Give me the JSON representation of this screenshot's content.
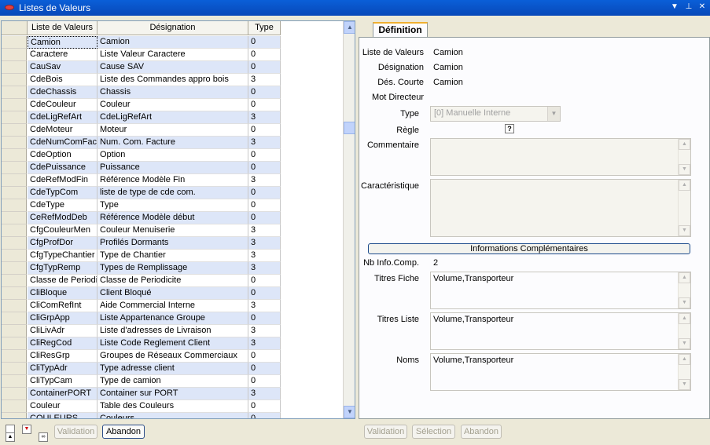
{
  "window": {
    "title": "Listes de Valeurs"
  },
  "grid": {
    "headers": [
      "Liste de Valeurs",
      "Désignation",
      "Type"
    ],
    "rows": [
      [
        "Camion",
        "Camion",
        "0"
      ],
      [
        "Caractere",
        "Liste Valeur Caractere",
        "0"
      ],
      [
        "CauSav",
        "Cause SAV",
        "0"
      ],
      [
        "CdeBois",
        "Liste des Commandes appro bois",
        "3"
      ],
      [
        "CdeChassis",
        "Chassis",
        "0"
      ],
      [
        "CdeCouleur",
        "Couleur",
        "0"
      ],
      [
        "CdeLigRefArt",
        "CdeLigRefArt",
        "3"
      ],
      [
        "CdeMoteur",
        "Moteur",
        "0"
      ],
      [
        "CdeNumComFacture",
        "Num. Com. Facture",
        "3"
      ],
      [
        "CdeOption",
        "Option",
        "0"
      ],
      [
        "CdePuissance",
        "Puissance",
        "0"
      ],
      [
        "CdeRefModFin",
        "Référence Modèle Fin",
        "3"
      ],
      [
        "CdeTypCom",
        "liste de type de cde com.",
        "0"
      ],
      [
        "CdeType",
        "Type",
        "0"
      ],
      [
        "CeRefModDeb",
        "Référence Modèle début",
        "0"
      ],
      [
        "CfgCouleurMen",
        "Couleur Menuiserie",
        "3"
      ],
      [
        "CfgProfDor",
        "Profilés Dormants",
        "3"
      ],
      [
        "CfgTypeChantier",
        "Type de Chantier",
        "3"
      ],
      [
        "CfgTypRemp",
        "Types de Remplissage",
        "3"
      ],
      [
        "Classe de Periodicite",
        "Classe de Periodicite",
        "0"
      ],
      [
        "CliBloque",
        "Client Bloqué",
        "0"
      ],
      [
        "CliComRefInt",
        "Aide Commercial Interne",
        "3"
      ],
      [
        "CliGrpApp",
        "Liste Appartenance Groupe",
        "0"
      ],
      [
        "CliLivAdr",
        "Liste d'adresses de Livraison",
        "3"
      ],
      [
        "CliRegCod",
        "Liste Code Reglement Client",
        "3"
      ],
      [
        "CliResGrp",
        "Groupes de Réseaux Commerciaux",
        "0"
      ],
      [
        "CliTypAdr",
        "Type adresse client",
        "0"
      ],
      [
        "CliTypCam",
        "Type de camion",
        "0"
      ],
      [
        "ContainerPORT",
        "Container sur PORT",
        "3"
      ],
      [
        "Couleur",
        "Table des Couleurs",
        "0"
      ],
      [
        "COULEURS",
        "Couleurs",
        "0"
      ]
    ]
  },
  "definition": {
    "tab_label": "Définition",
    "fields": {
      "liste_label": "Liste de Valeurs",
      "liste_value": "Camion",
      "designation_label": "Désignation",
      "designation_value": "Camion",
      "des_courte_label": "Dés. Courte",
      "des_courte_value": "Camion",
      "mot_directeur_label": "Mot Directeur",
      "type_label": "Type",
      "type_value": "[0] Manuelle Interne",
      "regle_label": "Règle",
      "regle_help": "?",
      "commentaire_label": "Commentaire",
      "caracteristique_label": "Caractéristique",
      "info_button": "Informations Complémentaires",
      "nb_info_label": "Nb Info.Comp.",
      "nb_info_value": "2",
      "titres_fiche_label": "Titres Fiche",
      "titres_fiche_value": "Volume,Transporteur",
      "titres_liste_label": "Titres Liste",
      "titres_liste_value": "Volume,Transporteur",
      "noms_label": "Noms",
      "noms_value": "Volume,Transporteur"
    }
  },
  "buttons": {
    "left_validation": "Validation",
    "left_abandon": "Abandon",
    "right_validation": "Validation",
    "right_selection": "Sélection",
    "right_abandon": "Abandon"
  },
  "icons": {
    "app": "lips-icon",
    "menu": "dropdown-arrow-icon",
    "pin": "pin-icon",
    "close": "close-icon"
  },
  "colors": {
    "titlebar": "#0a5fd8",
    "row_alt": "#dde6f8",
    "tab_accent": "#f0b030"
  }
}
